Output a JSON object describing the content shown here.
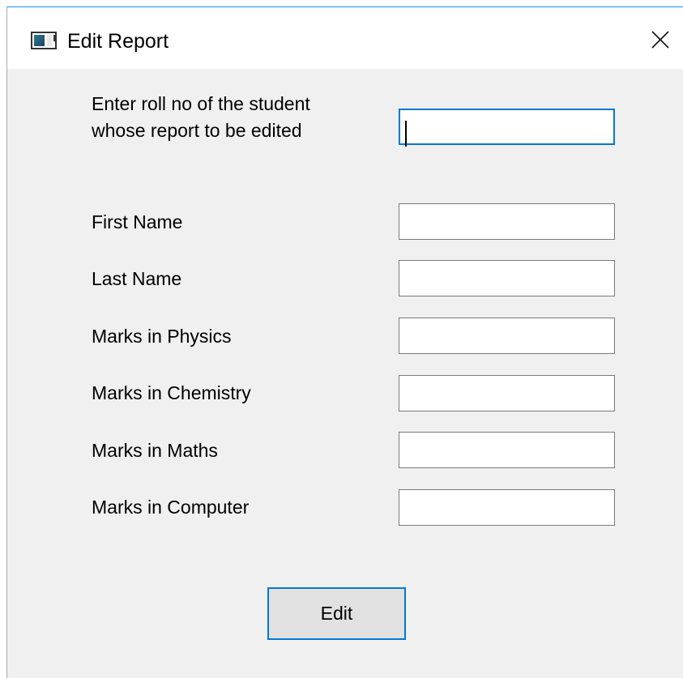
{
  "window": {
    "title": "Edit Report",
    "icon": "app-window-icon",
    "close_icon": "close-icon"
  },
  "form": {
    "prompt_line1": "Enter roll no of the student",
    "prompt_line2": "whose report to be edited",
    "roll_no": {
      "value": "",
      "focused": true
    },
    "fields": [
      {
        "label": "First Name",
        "value": ""
      },
      {
        "label": "Last Name",
        "value": ""
      },
      {
        "label": "Marks in Physics",
        "value": ""
      },
      {
        "label": "Marks in Chemistry",
        "value": ""
      },
      {
        "label": "Marks in Maths",
        "value": ""
      },
      {
        "label": "Marks in Computer",
        "value": ""
      }
    ],
    "edit_label": "Edit"
  },
  "colors": {
    "accent": "#0078d7",
    "window_bg": "#f0f0f0",
    "button_bg": "#e1e1e1"
  }
}
